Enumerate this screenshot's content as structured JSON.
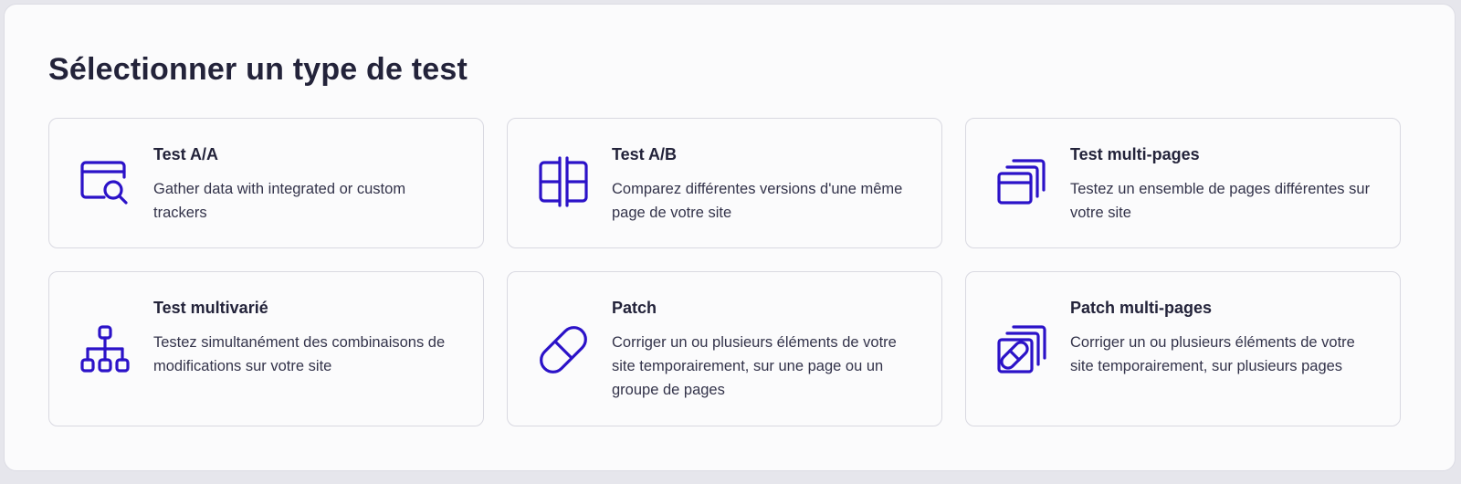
{
  "page": {
    "title": "Sélectionner un type de test"
  },
  "accent_color": "#2b12c8",
  "cards": [
    {
      "icon": "search-window-icon",
      "title": "Test A/A",
      "description": "Gather data with integrated or custom trackers"
    },
    {
      "icon": "split-layout-icon",
      "title": "Test A/B",
      "description": "Comparez différentes versions d'une même page de votre site"
    },
    {
      "icon": "stacked-windows-icon",
      "title": "Test multi-pages",
      "description": "Testez un ensemble de pages différentes sur votre site"
    },
    {
      "icon": "hierarchy-tree-icon",
      "title": "Test multivarié",
      "description": "Testez simultanément des combinaisons de modifications sur votre site"
    },
    {
      "icon": "bandage-icon",
      "title": "Patch",
      "description": "Corriger un ou plusieurs éléments de votre site temporairement, sur une page ou un groupe de pages"
    },
    {
      "icon": "stacked-bandage-icon",
      "title": "Patch multi-pages",
      "description": "Corriger un ou plusieurs éléments de votre site temporairement, sur plusieurs pages"
    }
  ]
}
